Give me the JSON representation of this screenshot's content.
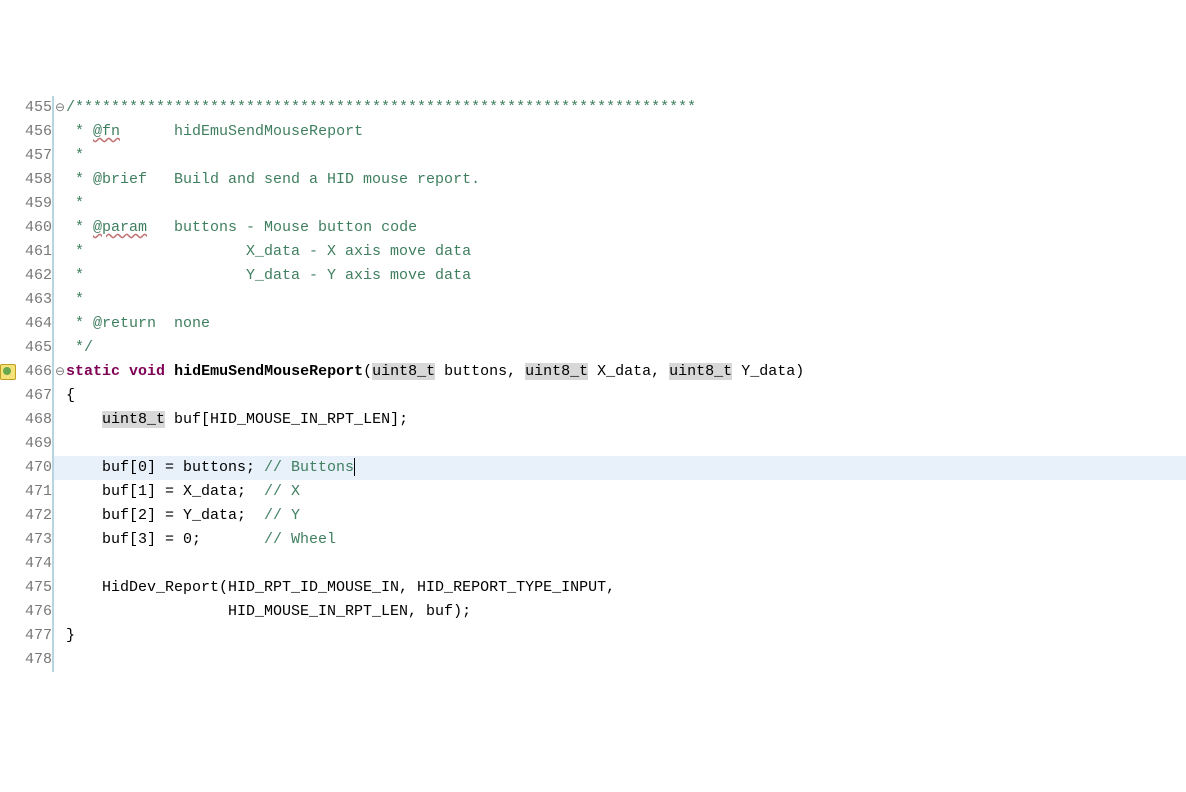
{
  "lines": [
    {
      "num": "455",
      "fold": "⊖",
      "segs": [
        {
          "cls": "tok-comment",
          "t": "/*********************************************************************"
        }
      ]
    },
    {
      "num": "456",
      "segs": [
        {
          "cls": "tok-comment",
          "t": " * "
        },
        {
          "cls": "tok-doctag",
          "t": "@fn"
        },
        {
          "cls": "tok-comment",
          "t": "      hidEmuSendMouseReport"
        }
      ]
    },
    {
      "num": "457",
      "segs": [
        {
          "cls": "tok-comment",
          "t": " *"
        }
      ]
    },
    {
      "num": "458",
      "segs": [
        {
          "cls": "tok-comment",
          "t": " * @brief   Build and send a HID mouse report."
        }
      ]
    },
    {
      "num": "459",
      "segs": [
        {
          "cls": "tok-comment",
          "t": " *"
        }
      ]
    },
    {
      "num": "460",
      "segs": [
        {
          "cls": "tok-comment",
          "t": " * "
        },
        {
          "cls": "tok-doctag",
          "t": "@param"
        },
        {
          "cls": "tok-comment",
          "t": "   buttons - Mouse button code"
        }
      ]
    },
    {
      "num": "461",
      "segs": [
        {
          "cls": "tok-comment",
          "t": " *                  X_data - X axis move data"
        }
      ]
    },
    {
      "num": "462",
      "segs": [
        {
          "cls": "tok-comment",
          "t": " *                  Y_data - Y axis move data"
        }
      ]
    },
    {
      "num": "463",
      "segs": [
        {
          "cls": "tok-comment",
          "t": " *"
        }
      ]
    },
    {
      "num": "464",
      "segs": [
        {
          "cls": "tok-comment",
          "t": " * @return  none"
        }
      ]
    },
    {
      "num": "465",
      "segs": [
        {
          "cls": "tok-comment",
          "t": " */"
        }
      ]
    },
    {
      "num": "466",
      "fold": "⊖",
      "marker": true,
      "segs": [
        {
          "cls": "tok-keyword",
          "t": "static"
        },
        {
          "cls": "tok-plain",
          "t": " "
        },
        {
          "cls": "tok-keyword",
          "t": "void"
        },
        {
          "cls": "tok-plain",
          "t": " "
        },
        {
          "cls": "tok-funcname",
          "t": "hidEmuSendMouseReport"
        },
        {
          "cls": "tok-plain",
          "t": "("
        },
        {
          "cls": "tok-type-hl",
          "t": "uint8_t"
        },
        {
          "cls": "tok-plain",
          "t": " buttons, "
        },
        {
          "cls": "tok-type-hl",
          "t": "uint8_t"
        },
        {
          "cls": "tok-plain",
          "t": " X_data, "
        },
        {
          "cls": "tok-type-hl",
          "t": "uint8_t"
        },
        {
          "cls": "tok-plain",
          "t": " Y_data)"
        }
      ]
    },
    {
      "num": "467",
      "segs": [
        {
          "cls": "tok-plain",
          "t": "{"
        }
      ]
    },
    {
      "num": "468",
      "segs": [
        {
          "cls": "tok-plain",
          "t": "    "
        },
        {
          "cls": "tok-type-hl",
          "t": "uint8_t"
        },
        {
          "cls": "tok-plain",
          "t": " buf[HID_MOUSE_IN_RPT_LEN];"
        }
      ]
    },
    {
      "num": "469",
      "segs": [
        {
          "cls": "tok-plain",
          "t": ""
        }
      ]
    },
    {
      "num": "470",
      "highlight": true,
      "cursor": true,
      "segs": [
        {
          "cls": "tok-plain",
          "t": "    buf[0] = buttons; "
        },
        {
          "cls": "tok-comment",
          "t": "// Buttons"
        }
      ]
    },
    {
      "num": "471",
      "segs": [
        {
          "cls": "tok-plain",
          "t": "    buf[1] = X_data;  "
        },
        {
          "cls": "tok-comment",
          "t": "// X"
        }
      ]
    },
    {
      "num": "472",
      "segs": [
        {
          "cls": "tok-plain",
          "t": "    buf[2] = Y_data;  "
        },
        {
          "cls": "tok-comment",
          "t": "// Y"
        }
      ]
    },
    {
      "num": "473",
      "segs": [
        {
          "cls": "tok-plain",
          "t": "    buf[3] = 0;       "
        },
        {
          "cls": "tok-comment",
          "t": "// Wheel"
        }
      ]
    },
    {
      "num": "474",
      "segs": [
        {
          "cls": "tok-plain",
          "t": ""
        }
      ]
    },
    {
      "num": "475",
      "segs": [
        {
          "cls": "tok-plain",
          "t": "    HidDev_Report(HID_RPT_ID_MOUSE_IN, HID_REPORT_TYPE_INPUT,"
        }
      ]
    },
    {
      "num": "476",
      "segs": [
        {
          "cls": "tok-plain",
          "t": "                  HID_MOUSE_IN_RPT_LEN, buf);"
        }
      ]
    },
    {
      "num": "477",
      "segs": [
        {
          "cls": "tok-plain",
          "t": "}"
        }
      ]
    },
    {
      "num": "478",
      "segs": [
        {
          "cls": "tok-plain",
          "t": ""
        }
      ]
    }
  ]
}
